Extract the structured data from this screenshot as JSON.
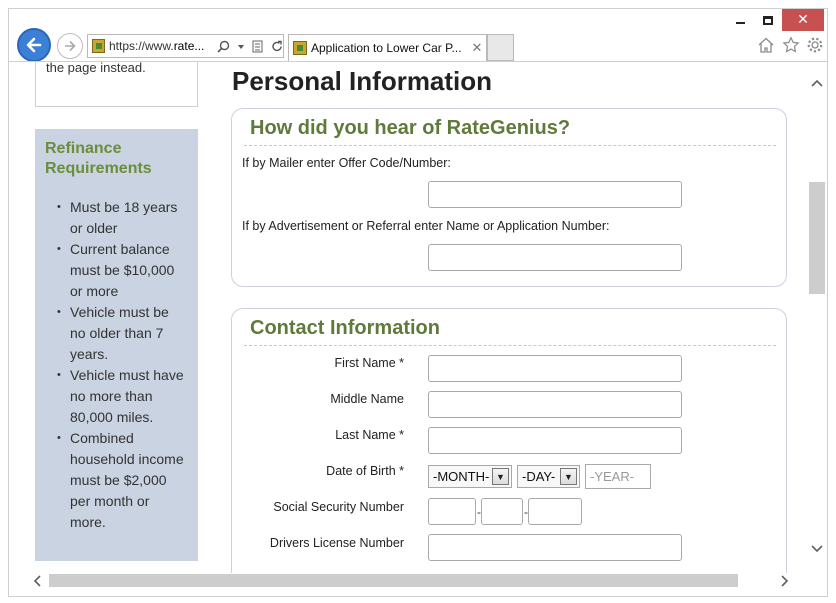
{
  "browser": {
    "address_prefix": "https://www.",
    "address_domain": "rate...",
    "tab_title": "Application to Lower Car P...",
    "tab_close": "✕",
    "close_glyph": "✕"
  },
  "sidebar": {
    "top_text": "the page instead.",
    "req_title": "Refinance Requirements",
    "requirements": [
      "Must be 18 years or older",
      "Current balance must be $10,000 or more",
      "Vehicle must be no older than 7 years.",
      "Vehicle must have no more than 80,000 miles.",
      "Combined household income must be $2,000 per month or more."
    ]
  },
  "main": {
    "page_title": "Personal Information",
    "hear": {
      "title": "How did you hear of RateGenius?",
      "mailer_label": "If by Mailer enter Offer Code/Number:",
      "mailer_value": "",
      "ad_label": "If by Advertisement or Referral enter Name or Application Number:",
      "ad_value": ""
    },
    "contact": {
      "title": "Contact Information",
      "first_name_label": "First Name *",
      "middle_name_label": "Middle Name",
      "last_name_label": "Last Name *",
      "dob_label": "Date of Birth *",
      "dob_month": "-MONTH-",
      "dob_day": "-DAY-",
      "dob_year_placeholder": "-YEAR-",
      "ssn_label": "Social Security Number",
      "ssn_dash": "-",
      "dl_label": "Drivers License Number"
    }
  },
  "colors": {
    "accent_green": "#5f7a3a",
    "sidebar_bg": "#c9d3e2",
    "back_button": "#3c7fd6",
    "close_red": "#c75050"
  }
}
